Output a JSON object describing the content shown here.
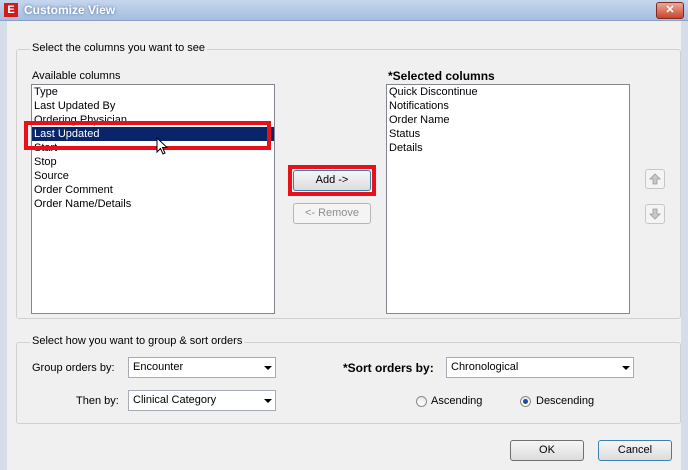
{
  "window": {
    "title": "Customize View",
    "app_icon_letter": "E",
    "close_label": "✕"
  },
  "columns_section": {
    "legend": "Select the columns you want to see",
    "available_label": "Available columns",
    "selected_label": "*Selected columns",
    "available_items": [
      "Type",
      "Last Updated By",
      "Ordering Physician",
      "Last Updated",
      "Start",
      "Stop",
      "Source",
      "Order Comment",
      "Order Name/Details"
    ],
    "selected_index": 3,
    "selected_items": [
      "Quick Discontinue",
      "Notifications",
      "Order Name",
      "Status",
      "Details"
    ],
    "add_label": "Add ->",
    "remove_label": "<- Remove",
    "move_up_icon": "up-arrow-icon",
    "move_down_icon": "down-arrow-icon"
  },
  "group_section": {
    "legend": "Select how you want to group & sort orders",
    "group_by_label": "Group orders by:",
    "group_by_value": "Encounter",
    "then_by_label": "Then by:",
    "then_by_value": "Clinical Category",
    "sort_by_label": "*Sort orders by:",
    "sort_by_value": "Chronological",
    "ascending_label": "Ascending",
    "descending_label": "Descending",
    "sort_direction": "Descending"
  },
  "footer": {
    "ok_label": "OK",
    "cancel_label": "Cancel"
  },
  "colors": {
    "selection": "#0a246a",
    "annotation": "#e8111b",
    "title_bar": "#a6bde0"
  }
}
